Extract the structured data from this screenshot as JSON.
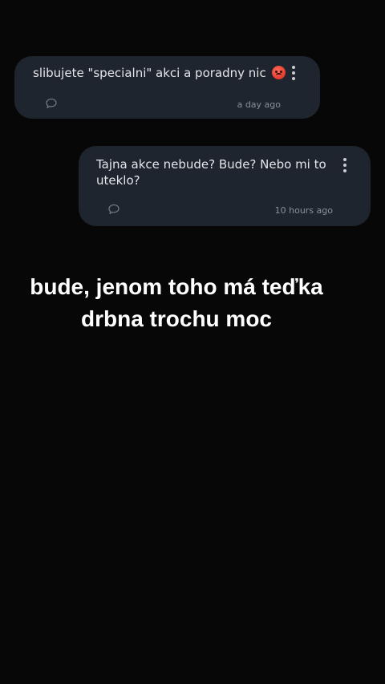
{
  "comments": [
    {
      "text": "slibujete \"specialni\" akci a poradny nic",
      "emoji": "angry-face-emoji",
      "time": "a day ago"
    },
    {
      "text": "Tajna akce nebude? Bude? Nebo mi to uteklo?",
      "time": "10 hours ago"
    }
  ],
  "caption": {
    "line1": "bude, jenom toho má teďka",
    "line2": "drbna trochu moc"
  },
  "colors": {
    "background": "#070707",
    "bubble": "#1f252e",
    "text": "#e4e6ea",
    "muted": "#8a9099"
  },
  "icons": [
    "comment-icon",
    "more-vertical-icon",
    "angry-face-emoji"
  ]
}
